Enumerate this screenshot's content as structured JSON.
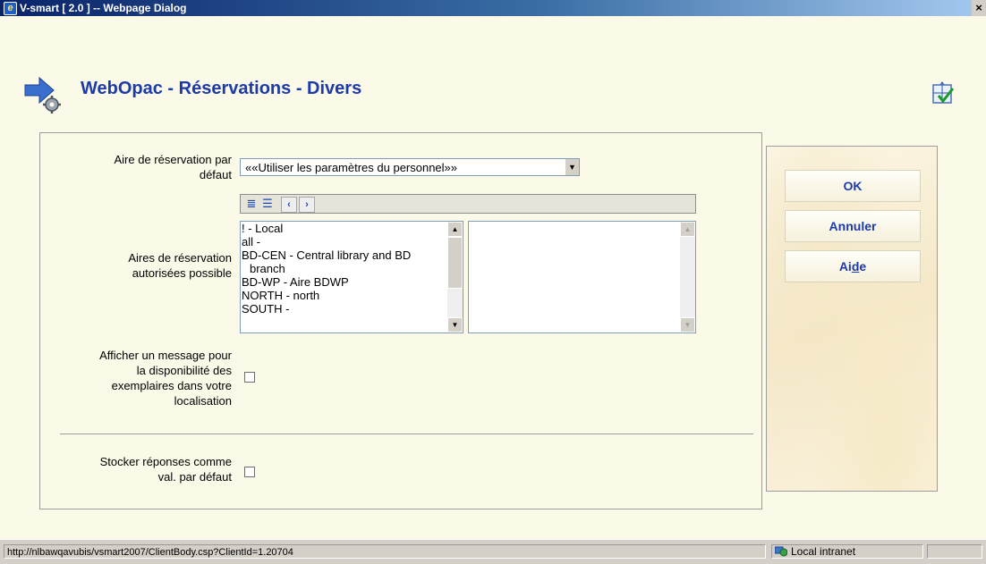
{
  "window": {
    "title": "V-smart [ 2.0 ] -- Webpage Dialog",
    "close_glyph": "×"
  },
  "header": {
    "title": "WebOpac - Réservations - Divers",
    "page_icon": "arrow-gear-icon",
    "corner_icon": "layout-check-icon"
  },
  "form": {
    "default_area": {
      "label_line1": "Aire de réservation par",
      "label_line2": "défaut",
      "selected": "««Utiliser les paramètres du personnel»»"
    },
    "allowed_areas": {
      "label_line1": "Aires de réservation",
      "label_line2": "autorisées possible",
      "toolbar_icons": [
        "select-all-icon",
        "deselect-all-icon",
        "move-left-icon",
        "move-right-icon"
      ],
      "available": [
        {
          "text": "! - Local"
        },
        {
          "text": "all -"
        },
        {
          "text": "BD-CEN - Central library and BD"
        },
        {
          "text": "branch",
          "indent": true
        },
        {
          "text": "BD-WP - Aire BDWP"
        },
        {
          "text": "NORTH - north"
        },
        {
          "text": "SOUTH -"
        }
      ],
      "selected": []
    },
    "availability_message": {
      "lines": [
        "Afficher un message pour",
        "la disponibilité des",
        "exemplaires dans votre",
        "localisation"
      ],
      "checked": false
    },
    "store_default": {
      "line1": "Stocker réponses comme",
      "line2": "val. par défaut",
      "checked": false
    }
  },
  "buttons": {
    "ok": "OK",
    "cancel": "Annuler",
    "help_pre": "Ai",
    "help_u": "d",
    "help_post": "e"
  },
  "statusbar": {
    "url": "http://nlbawqavubis/vsmart2007/ClientBody.csp?ClientId=1.20704",
    "zone": "Local intranet",
    "zone_icon": "intranet-globe-icon"
  },
  "colors": {
    "title_blue": "#1c3aa9",
    "background": "#fbf9e8",
    "titlebar_start": "#0a246a"
  }
}
